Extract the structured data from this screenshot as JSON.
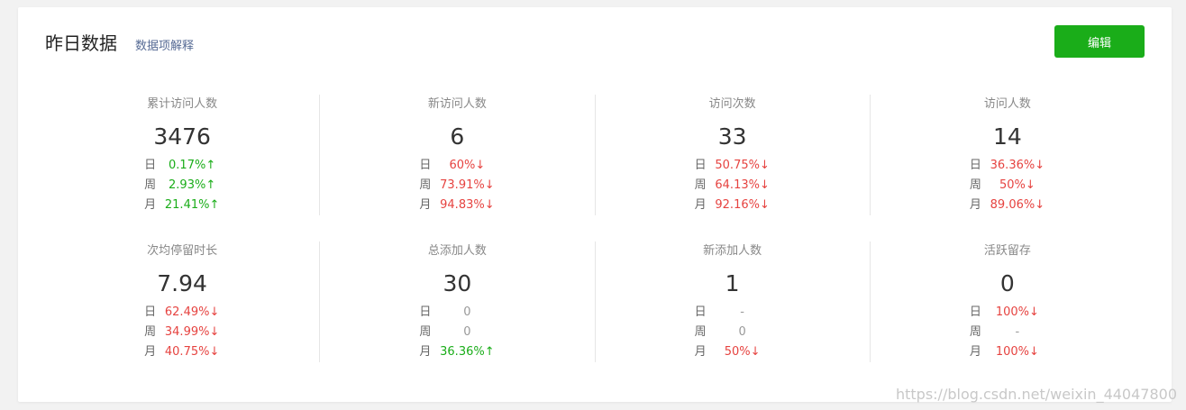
{
  "header": {
    "title": "昨日数据",
    "explain_link": "数据项解释",
    "edit_label": "编辑"
  },
  "colors": {
    "up": "#1aad19",
    "down": "#e64340",
    "accent": "#1aad19",
    "link": "#576b95"
  },
  "rows": [
    [
      {
        "label": "累计访问人数",
        "value": "3476",
        "cmp": [
          {
            "k": "日",
            "v": "0.17%↑",
            "trend": "up"
          },
          {
            "k": "周",
            "v": "2.93%↑",
            "trend": "up"
          },
          {
            "k": "月",
            "v": "21.41%↑",
            "trend": "up"
          }
        ]
      },
      {
        "label": "新访问人数",
        "value": "6",
        "cmp": [
          {
            "k": "日",
            "v": "60%↓",
            "trend": "down"
          },
          {
            "k": "周",
            "v": "73.91%↓",
            "trend": "down"
          },
          {
            "k": "月",
            "v": "94.83%↓",
            "trend": "down"
          }
        ]
      },
      {
        "label": "访问次数",
        "value": "33",
        "cmp": [
          {
            "k": "日",
            "v": "50.75%↓",
            "trend": "down"
          },
          {
            "k": "周",
            "v": "64.13%↓",
            "trend": "down"
          },
          {
            "k": "月",
            "v": "92.16%↓",
            "trend": "down"
          }
        ]
      },
      {
        "label": "访问人数",
        "value": "14",
        "cmp": [
          {
            "k": "日",
            "v": "36.36%↓",
            "trend": "down"
          },
          {
            "k": "周",
            "v": "50%↓",
            "trend": "down"
          },
          {
            "k": "月",
            "v": "89.06%↓",
            "trend": "down"
          }
        ]
      }
    ],
    [
      {
        "label": "次均停留时长",
        "value": "7.94",
        "cmp": [
          {
            "k": "日",
            "v": "62.49%↓",
            "trend": "down"
          },
          {
            "k": "周",
            "v": "34.99%↓",
            "trend": "down"
          },
          {
            "k": "月",
            "v": "40.75%↓",
            "trend": "down"
          }
        ]
      },
      {
        "label": "总添加人数",
        "value": "30",
        "cmp": [
          {
            "k": "日",
            "v": "0",
            "trend": "neutral"
          },
          {
            "k": "周",
            "v": "0",
            "trend": "neutral"
          },
          {
            "k": "月",
            "v": "36.36%↑",
            "trend": "up"
          }
        ]
      },
      {
        "label": "新添加人数",
        "value": "1",
        "cmp": [
          {
            "k": "日",
            "v": "-",
            "trend": "neutral"
          },
          {
            "k": "周",
            "v": "0",
            "trend": "neutral"
          },
          {
            "k": "月",
            "v": "50%↓",
            "trend": "down"
          }
        ]
      },
      {
        "label": "活跃留存",
        "value": "0",
        "cmp": [
          {
            "k": "日",
            "v": "100%↓",
            "trend": "down"
          },
          {
            "k": "周",
            "v": "-",
            "trend": "neutral"
          },
          {
            "k": "月",
            "v": "100%↓",
            "trend": "down"
          }
        ]
      }
    ]
  ],
  "watermark": "https://blog.csdn.net/weixin_44047800"
}
